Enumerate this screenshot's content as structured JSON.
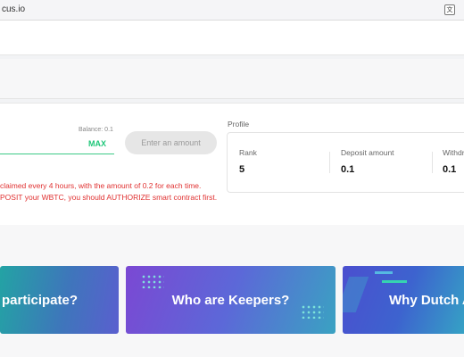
{
  "browser": {
    "url_text": "cus.io",
    "translate_icon": "文"
  },
  "deposit": {
    "balance_label": "Balance: 0.1",
    "max_label": "MAX",
    "button_label": "Enter an amount"
  },
  "messages": [
    "claimed every 4 hours, with the amount of 0.2 for each time.",
    "POSIT your WBTC, you should AUTHORIZE smart contract first."
  ],
  "profile": {
    "title": "Profile",
    "columns": [
      {
        "label": "Rank",
        "value": "5"
      },
      {
        "label": "Deposit amount",
        "value": "0.1"
      },
      {
        "label": "Withdr",
        "value": "0.1"
      }
    ]
  },
  "banners": [
    {
      "label": "participate?"
    },
    {
      "label": "Who are Keepers?"
    },
    {
      "label": "Why Dutch Au"
    }
  ],
  "colors": {
    "accent_green": "#20c77a",
    "error_red": "#e03131"
  }
}
